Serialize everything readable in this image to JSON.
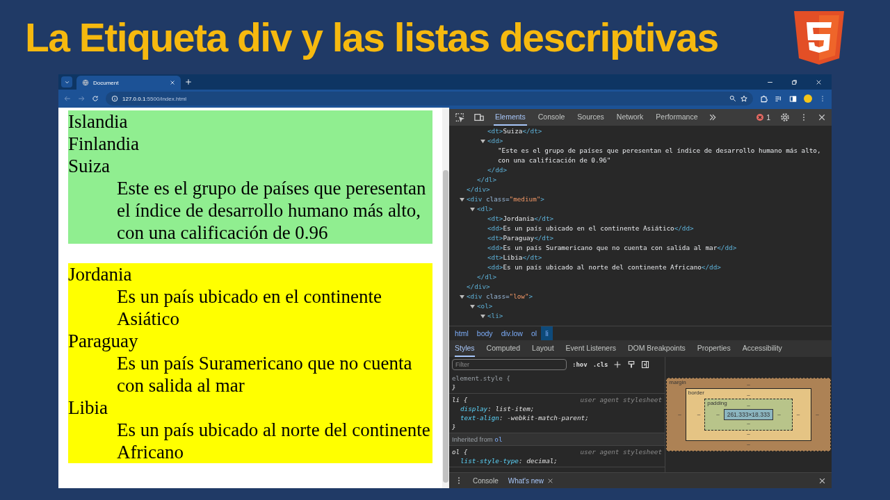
{
  "headline": "La Etiqueta div y las listas descriptivas",
  "browser": {
    "tab": {
      "title": "Document"
    },
    "address": {
      "host": "127.0.0.1",
      "path": ":5500/index.html"
    }
  },
  "page": {
    "blocks": [
      {
        "color": "#90ee90",
        "items": [
          {
            "kind": "term",
            "text": "Islandia"
          },
          {
            "kind": "term",
            "text": "Finlandia"
          },
          {
            "kind": "term",
            "text": "Suiza"
          },
          {
            "kind": "desc",
            "text": "Este es el grupo de países que peresentan el índice de desarrollo humano más alto, con una calificación de 0.96"
          }
        ]
      },
      {
        "color": "#ffff00",
        "items": [
          {
            "kind": "term",
            "text": "Jordania"
          },
          {
            "kind": "desc",
            "text": "Es un país ubicado en el continente Asiático"
          },
          {
            "kind": "term",
            "text": "Paraguay"
          },
          {
            "kind": "desc",
            "text": "Es un país Suramericano que no cuenta con salida al mar"
          },
          {
            "kind": "term",
            "text": "Libia"
          },
          {
            "kind": "desc",
            "text": "Es un país ubicado al norte del continente Africano"
          }
        ]
      }
    ]
  },
  "devtools": {
    "tabs": [
      {
        "label": "Elements",
        "selected": true
      },
      {
        "label": "Console",
        "selected": false
      },
      {
        "label": "Sources",
        "selected": false
      },
      {
        "label": "Network",
        "selected": false
      },
      {
        "label": "Performance",
        "selected": false
      }
    ],
    "error_count": "1",
    "dom": [
      {
        "close": "</div>",
        "children": [
          {
            "close": "</dl>",
            "children": [
              {
                "tokens": [
                  {
                    "kind": "tag",
                    "text": "<dt>"
                  },
                  {
                    "kind": "text",
                    "text": "Suiza"
                  },
                  {
                    "kind": "tag",
                    "text": "</dt>"
                  }
                ]
              },
              {
                "expanded": true,
                "tokens": [
                  {
                    "kind": "tag",
                    "text": "<dd>"
                  }
                ],
                "close": "</dd>",
                "children": [
                  {
                    "tokens": [
                      {
                        "kind": "text",
                        "text": "\"Este es el grupo de países que peresentan el índice de desarrollo humano más alto, con una calificación de 0.96\""
                      }
                    ]
                  }
                ]
              }
            ]
          }
        ]
      },
      {
        "expanded": true,
        "tokens": [
          {
            "kind": "tag",
            "text": "<div"
          },
          {
            "kind": "attr",
            "text": " class="
          },
          {
            "kind": "value",
            "text": "\"medium\""
          },
          {
            "kind": "tag",
            "text": ">"
          }
        ],
        "close": "</div>",
        "children": [
          {
            "expanded": true,
            "tokens": [
              {
                "kind": "tag",
                "text": "<dl>"
              }
            ],
            "close": "</dl>",
            "children": [
              {
                "tokens": [
                  {
                    "kind": "tag",
                    "text": "<dt>"
                  },
                  {
                    "kind": "text",
                    "text": "Jordania"
                  },
                  {
                    "kind": "tag",
                    "text": "</dt>"
                  }
                ]
              },
              {
                "tokens": [
                  {
                    "kind": "tag",
                    "text": "<dd>"
                  },
                  {
                    "kind": "text",
                    "text": "Es un país ubicado en el continente Asiático"
                  },
                  {
                    "kind": "tag",
                    "text": "</dd>"
                  }
                ]
              },
              {
                "tokens": [
                  {
                    "kind": "tag",
                    "text": "<dt>"
                  },
                  {
                    "kind": "text",
                    "text": "Paraguay"
                  },
                  {
                    "kind": "tag",
                    "text": "</dt>"
                  }
                ]
              },
              {
                "tokens": [
                  {
                    "kind": "tag",
                    "text": "<dd>"
                  },
                  {
                    "kind": "text",
                    "text": "Es un país Suramericano que no cuenta con salida al mar"
                  },
                  {
                    "kind": "tag",
                    "text": "</dd>"
                  }
                ]
              },
              {
                "tokens": [
                  {
                    "kind": "tag",
                    "text": "<dt>"
                  },
                  {
                    "kind": "text",
                    "text": "Libia"
                  },
                  {
                    "kind": "tag",
                    "text": "</dt>"
                  }
                ]
              },
              {
                "tokens": [
                  {
                    "kind": "tag",
                    "text": "<dd>"
                  },
                  {
                    "kind": "text",
                    "text": "Es un país ubicado al norte del continente Africano"
                  },
                  {
                    "kind": "tag",
                    "text": "</dd>"
                  }
                ]
              }
            ]
          }
        ]
      },
      {
        "expanded": true,
        "tokens": [
          {
            "kind": "tag",
            "text": "<div"
          },
          {
            "kind": "attr",
            "text": " class="
          },
          {
            "kind": "value",
            "text": "\"low\""
          },
          {
            "kind": "tag",
            "text": ">"
          }
        ],
        "children": [
          {
            "expanded": true,
            "tokens": [
              {
                "kind": "tag",
                "text": "<ol>"
              }
            ],
            "children": [
              {
                "expanded": true,
                "tokens": [
                  {
                    "kind": "tag",
                    "text": "<li>"
                  }
                ]
              }
            ]
          }
        ]
      }
    ],
    "breadcrumb": [
      {
        "label": "html",
        "selected": false
      },
      {
        "label": "body",
        "selected": false
      },
      {
        "label": "div.low",
        "selected": false
      },
      {
        "label": "ol",
        "selected": false
      },
      {
        "label": "li",
        "selected": true
      }
    ],
    "subtabs": [
      {
        "label": "Styles",
        "selected": true
      },
      {
        "label": "Computed",
        "selected": false
      },
      {
        "label": "Layout",
        "selected": false
      },
      {
        "label": "Event Listeners",
        "selected": false
      },
      {
        "label": "DOM Breakpoints",
        "selected": false
      },
      {
        "label": "Properties",
        "selected": false
      },
      {
        "label": "Accessibility",
        "selected": false
      }
    ],
    "filter": {
      "placeholder": "Filter"
    },
    "toggles": [
      ":hov",
      ".cls"
    ],
    "rules": [
      {
        "selector": "element.style {",
        "end": "}"
      },
      {
        "selector": "li {",
        "origin": "user agent stylesheet",
        "declarations": [
          {
            "property": "display",
            "separator": ":",
            "value": "list-item;"
          },
          {
            "property": "text-align",
            "separator": ":",
            "value": "-webkit-match-parent;"
          }
        ],
        "end": "}"
      },
      {
        "kind": "inherited",
        "label": "Inherited from",
        "source": "ol"
      },
      {
        "selector": "ol {",
        "origin": "user agent stylesheet",
        "declarations": [
          {
            "property": "list-style-type",
            "separator": ":",
            "value": "decimal;"
          }
        ]
      }
    ],
    "box_model": {
      "margin": "margin",
      "border": "border",
      "padding": "padding",
      "dash": "–",
      "content": "261.333×18.333"
    },
    "drawer": [
      {
        "label": "Console",
        "selected": false,
        "closable": false
      },
      {
        "label": "What's new",
        "selected": true,
        "closable": true
      }
    ]
  }
}
